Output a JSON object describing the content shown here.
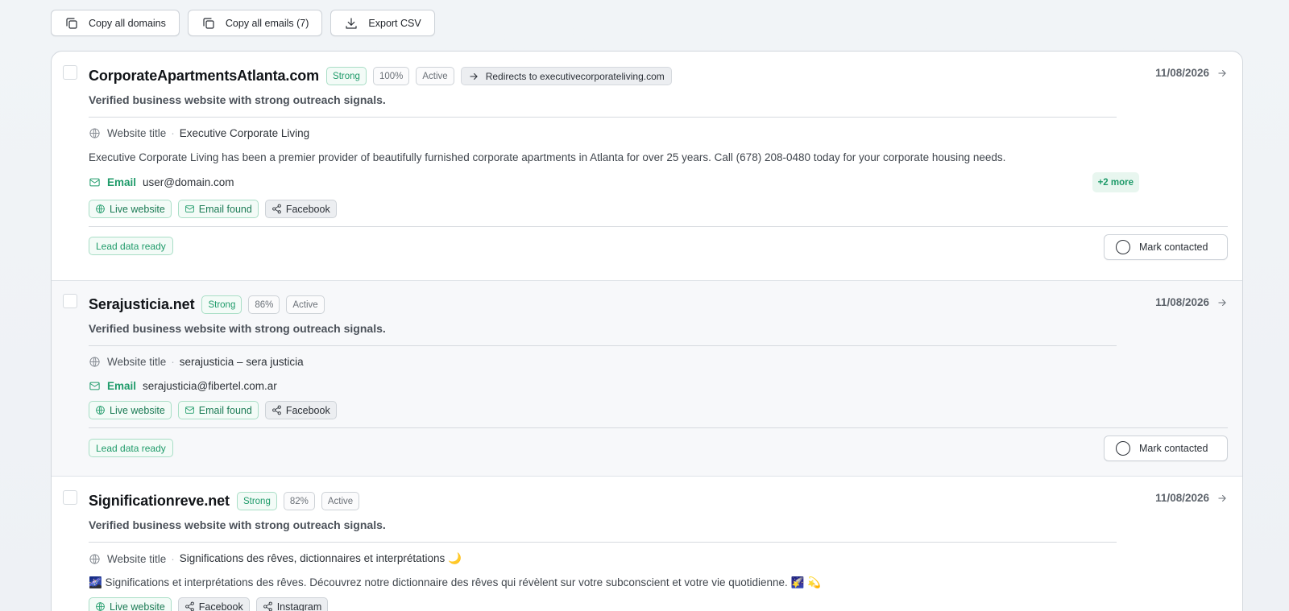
{
  "toolbar": {
    "copy_domains": "Copy all domains",
    "copy_emails": "Copy all emails (7)",
    "export_csv": "Export CSV"
  },
  "colors": {
    "accent_green": "#1f9b6a",
    "border": "#cdd2d8",
    "muted_text": "#5d636b"
  },
  "cards": [
    {
      "domain": "CorporateApartmentsAtlanta.com",
      "strength": "Strong",
      "score": "100%",
      "status": "Active",
      "redirect": "Redirects to executivecorporateliving.com",
      "date": "11/08/2026",
      "subtitle": "Verified business website with strong outreach signals.",
      "website_title_label": "Website title",
      "website_title_sep": "·",
      "website_title": "Executive Corporate Living",
      "description": "Executive Corporate Living has been a premier provider of beautifully furnished corporate apartments in Atlanta for over 25 years. Call (678) 208-0480 today for your corporate housing needs.",
      "email_label": "Email",
      "email": "user@domain.com",
      "more": "+2 more",
      "tags": [
        "Live website",
        "Email found",
        "Facebook"
      ],
      "lead": "Lead data ready",
      "mark": "Mark contacted"
    },
    {
      "domain": "Serajusticia.net",
      "strength": "Strong",
      "score": "86%",
      "status": "Active",
      "date": "11/08/2026",
      "subtitle": "Verified business website with strong outreach signals.",
      "website_title_label": "Website title",
      "website_title_sep": "·",
      "website_title": "serajusticia – sera justicia",
      "email_label": "Email",
      "email": "serajusticia@fibertel.com.ar",
      "tags": [
        "Live website",
        "Email found",
        "Facebook"
      ],
      "lead": "Lead data ready",
      "mark": "Mark contacted"
    },
    {
      "domain": "Significationreve.net",
      "strength": "Strong",
      "score": "82%",
      "status": "Active",
      "date": "11/08/2026",
      "subtitle": "Verified business website with strong outreach signals.",
      "website_title_label": "Website title",
      "website_title_sep": "·",
      "website_title": "Significations des rêves, dictionnaires et interprétations 🌙",
      "description": "🌌 Significations et interprétations des rêves. Découvrez notre dictionnaire des rêves qui révèlent sur votre subconscient et votre vie quotidienne. 🌠 💫",
      "tags": [
        "Live website",
        "Facebook",
        "Instagram"
      ]
    }
  ]
}
